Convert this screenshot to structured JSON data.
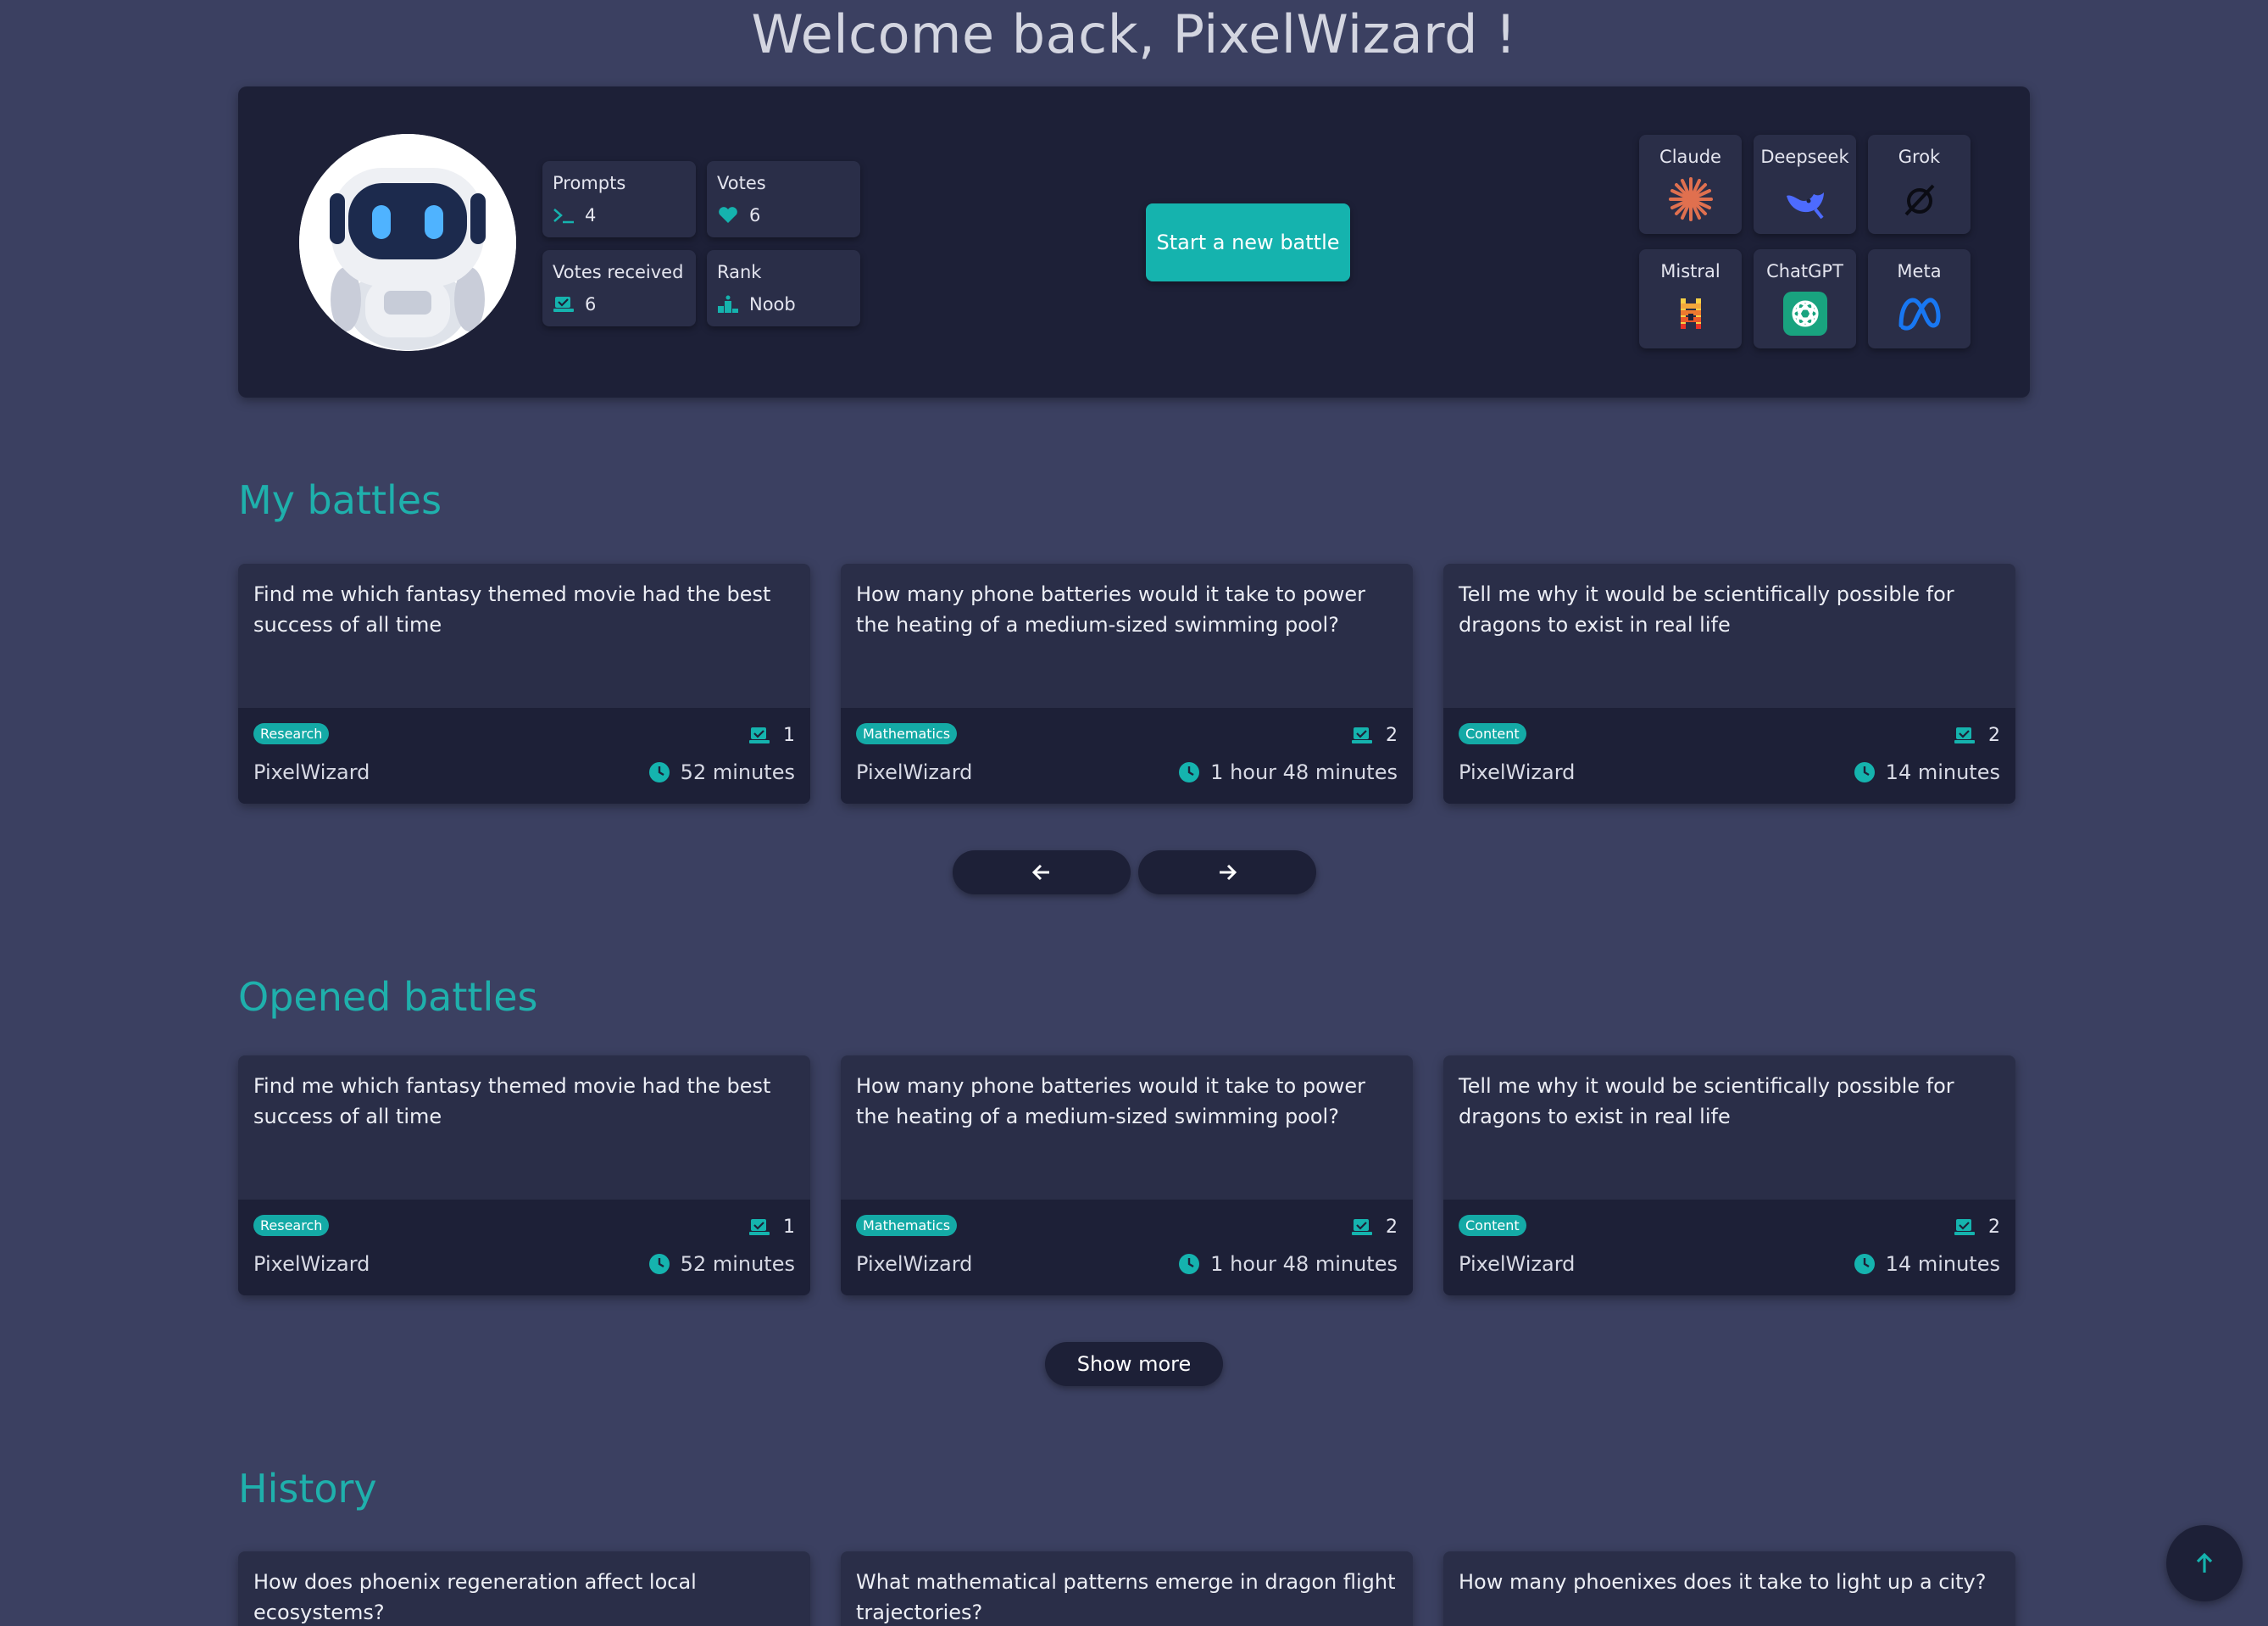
{
  "welcome": "Welcome back, PixelWizard !",
  "stats": {
    "prompts": {
      "label": "Prompts",
      "value": "4",
      "icon": "terminal-icon"
    },
    "votes": {
      "label": "Votes",
      "value": "6",
      "icon": "heart-icon"
    },
    "votes_received": {
      "label": "Votes received",
      "value": "6",
      "icon": "inbox-check-icon"
    },
    "rank": {
      "label": "Rank",
      "value": "Noob",
      "icon": "podium-icon"
    }
  },
  "start_button": "Start a new battle",
  "models": [
    {
      "name": "Claude",
      "icon": "claude-logo-icon"
    },
    {
      "name": "Deepseek",
      "icon": "deepseek-logo-icon"
    },
    {
      "name": "Grok",
      "icon": "grok-logo-icon"
    },
    {
      "name": "Mistral",
      "icon": "mistral-logo-icon"
    },
    {
      "name": "ChatGPT",
      "icon": "chatgpt-logo-icon"
    },
    {
      "name": "Meta",
      "icon": "meta-logo-icon"
    }
  ],
  "my_battles": {
    "title": "My battles",
    "cards": [
      {
        "question": "Find me which fantasy themed movie had the best success of all time",
        "tag": "Research",
        "votes": "1",
        "author": "PixelWizard",
        "time": "52 minutes"
      },
      {
        "question": "How many phone batteries would it take to power the heating of a medium-sized swimming pool?",
        "tag": "Mathematics",
        "votes": "2",
        "author": "PixelWizard",
        "time": "1 hour 48 minutes"
      },
      {
        "question": "Tell me why it would be scientifically possible for dragons to exist in real life",
        "tag": "Content",
        "votes": "2",
        "author": "PixelWizard",
        "time": "14 minutes"
      }
    ]
  },
  "opened_battles": {
    "title": "Opened battles",
    "cards": [
      {
        "question": "Find me which fantasy themed movie had the best success of all time",
        "tag": "Research",
        "votes": "1",
        "author": "PixelWizard",
        "time": "52 minutes"
      },
      {
        "question": "How many phone batteries would it take to power the heating of a medium-sized swimming pool?",
        "tag": "Mathematics",
        "votes": "2",
        "author": "PixelWizard",
        "time": "1 hour 48 minutes"
      },
      {
        "question": "Tell me why it would be scientifically possible for dragons to exist in real life",
        "tag": "Content",
        "votes": "2",
        "author": "PixelWizard",
        "time": "14 minutes"
      }
    ],
    "show_more": "Show more"
  },
  "history": {
    "title": "History",
    "cards": [
      {
        "question": "How does phoenix regeneration affect local ecosystems?"
      },
      {
        "question": "What mathematical patterns emerge in dragon flight trajectories?"
      },
      {
        "question": "How many phoenixes does it take to light up a city?"
      }
    ]
  },
  "colors": {
    "background": "#3b4061",
    "panel": "#1d2037",
    "card": "#2a2e48",
    "accent": "#15b3ae"
  }
}
